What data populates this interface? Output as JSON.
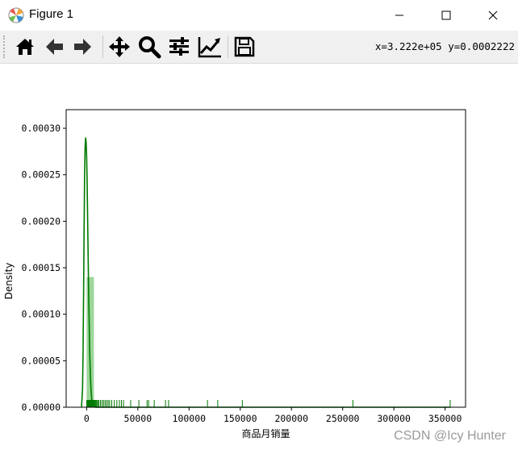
{
  "window": {
    "title": "Figure 1",
    "coords_readout": "x=3.222e+05 y=0.0002222"
  },
  "toolbar": {
    "tools": [
      {
        "name": "home-icon",
        "label": "Home"
      },
      {
        "name": "back-icon",
        "label": "Back"
      },
      {
        "name": "forward-icon",
        "label": "Forward"
      },
      {
        "name": "pan-icon",
        "label": "Pan"
      },
      {
        "name": "zoom-icon",
        "label": "Zoom"
      },
      {
        "name": "subplots-icon",
        "label": "Configure subplots"
      },
      {
        "name": "edit-axis-icon",
        "label": "Edit axis"
      },
      {
        "name": "save-icon",
        "label": "Save"
      }
    ]
  },
  "watermark": "CSDN @Icy Hunter",
  "chart_data": {
    "type": "bar",
    "xlabel": "商品月销量",
    "ylabel": "Density",
    "xlim": [
      -20000,
      370000
    ],
    "ylim": [
      0,
      0.00032
    ],
    "x_ticks": [
      0,
      50000,
      100000,
      150000,
      200000,
      250000,
      300000,
      350000
    ],
    "x_tick_labels": [
      "0",
      "50000",
      "100000",
      "150000",
      "200000",
      "250000",
      "300000",
      "350000"
    ],
    "y_ticks": [
      0,
      5e-05,
      0.0001,
      0.00015,
      0.0002,
      0.00025,
      0.0003
    ],
    "y_tick_labels": [
      "0.00000",
      "0.00005",
      "0.00010",
      "0.00015",
      "0.00020",
      "0.00025",
      "0.00030"
    ],
    "colors": {
      "histogram": "#9cd69a",
      "kde": "#007a00",
      "rug": "#007a00"
    },
    "histogram": {
      "bins": [
        {
          "x0": 0,
          "x1": 7100,
          "density": 0.00014
        }
      ]
    },
    "kde": {
      "x": [
        -5000,
        -4000,
        -3500,
        -3000,
        -2500,
        -2000,
        -1500,
        -1000,
        -500,
        0,
        500,
        1000,
        1500,
        2000,
        2500,
        3000,
        3500,
        4000,
        4500,
        5000,
        5500,
        6000,
        6500,
        7000,
        8000,
        9000,
        12000,
        20000,
        50000,
        100000,
        150000,
        200000,
        250000,
        300000,
        355000
      ],
      "y": [
        0.0,
        2e-05,
        6e-05,
        0.00012,
        0.00019,
        0.00025,
        0.00028,
        0.00029,
        0.000285,
        0.00027,
        0.00024,
        0.0002,
        0.00016,
        0.00012,
        9e-05,
        6e-05,
        4e-05,
        2.5e-05,
        1.5e-05,
        8e-06,
        4e-06,
        2e-06,
        1e-06,
        5e-07,
        1e-07,
        0.0,
        0.0,
        0.0,
        0.0,
        0.0,
        0.0,
        0.0,
        0.0,
        0.0,
        0.0
      ]
    },
    "rug": [
      150,
      400,
      700,
      1000,
      1300,
      1600,
      1900,
      2200,
      2500,
      2800,
      3100,
      3400,
      3700,
      4000,
      4300,
      4600,
      5000,
      5400,
      5800,
      6200,
      6700,
      7200,
      7800,
      8500,
      9200,
      10000,
      11000,
      12000,
      13500,
      15000,
      16500,
      18000,
      19500,
      21000,
      22500,
      24500,
      27000,
      29500,
      32000,
      34000,
      36000,
      43000,
      51000,
      59000,
      60500,
      66000,
      77000,
      80000,
      118000,
      128000,
      152000,
      260000,
      355000
    ]
  }
}
